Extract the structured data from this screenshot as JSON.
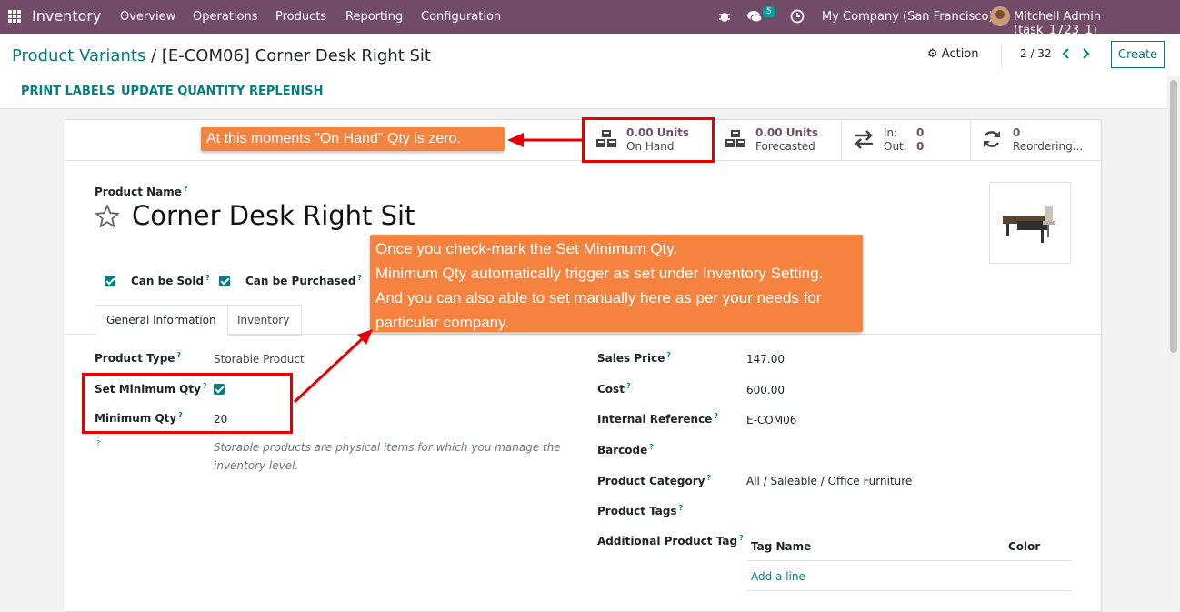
{
  "topnav": {
    "app": "Inventory",
    "menu": [
      "Overview",
      "Operations",
      "Products",
      "Reporting",
      "Configuration"
    ],
    "chat_count": "5",
    "company": "My Company (San Francisco)",
    "user": "Mitchell Admin (task_1723_1)",
    "brand_color": "#714B67"
  },
  "control": {
    "breadcrumb_parent": "Product Variants",
    "breadcrumb_sep": "/",
    "breadcrumb_current": "[E-COM06] Corner Desk Right Sit",
    "action": "Action",
    "pager": "2 / 32",
    "create": "Create"
  },
  "header_buttons": [
    "PRINT LABELS",
    "UPDATE QUANTITY",
    "REPLENISH"
  ],
  "stats": {
    "onhand_value": "0.00 Units",
    "onhand_label": "On Hand",
    "forecast_value": "0.00 Units",
    "forecast_label": "Forecasted",
    "inout_in_label": "In:",
    "inout_in_value": "0",
    "inout_out_label": "Out:",
    "inout_out_value": "0",
    "reorder_value": "0",
    "reorder_label": "Reordering..."
  },
  "form": {
    "product_name_label": "Product Name",
    "product_name": "Corner Desk Right Sit",
    "can_be_sold": "Can be Sold",
    "can_be_purchased": "Can be Purchased",
    "tabs": [
      "General Information",
      "Inventory"
    ],
    "product_type_label": "Product Type",
    "product_type": "Storable Product",
    "set_min_qty_label": "Set Minimum Qty",
    "min_qty_label": "Minimum Qty",
    "min_qty": "20",
    "hint_line1": "Storable products are physical items for which you manage the",
    "hint_line2": "inventory level.",
    "sales_price_label": "Sales Price",
    "sales_price": "147.00",
    "cost_label": "Cost",
    "cost": "600.00",
    "internal_ref_label": "Internal Reference",
    "internal_ref": "E-COM06",
    "barcode_label": "Barcode",
    "category_label": "Product Category",
    "category": "All / Saleable / Office Furniture",
    "tags_label": "Product Tags",
    "additional_tag_label": "Additional Product Tag",
    "tag_name_col": "Tag Name",
    "color_col": "Color",
    "add_line": "Add a line",
    "help_mark": "?"
  },
  "annotations": {
    "callout_onhand": "At this moments \"On Hand\" Qty is zero.",
    "callout_min_lines": [
      "Once you check-mark the Set Minimum Qty.",
      "Minimum Qty automatically trigger as set under Inventory Setting.",
      "And you can also able to set manually here as per your needs for",
      "particular company."
    ],
    "callout_color": "#f5823e",
    "highlight_color": "#e50000"
  }
}
